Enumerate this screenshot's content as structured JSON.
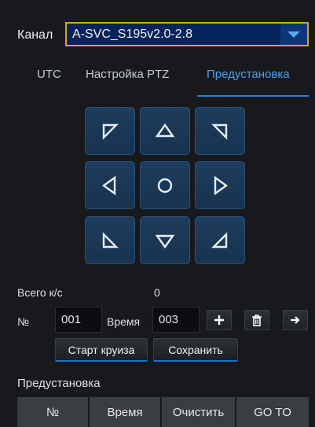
{
  "channel": {
    "label": "Канал",
    "value": "A-SVC_S195v2.0-2.8"
  },
  "tabs": [
    {
      "label": "UTC"
    },
    {
      "label": "Настройка PTZ"
    },
    {
      "label": "Предустановка"
    }
  ],
  "active_tab": "Предустановка",
  "ptz_pad": {
    "buttons": [
      "up-left",
      "up",
      "up-right",
      "left",
      "center",
      "right",
      "down-left",
      "down",
      "down-right"
    ]
  },
  "cruise": {
    "total_label": "Всего к/с",
    "total_value": "0",
    "number_label": "№",
    "number_value": "001",
    "time_label": "Время",
    "time_value": "003",
    "buttons": [
      "add-icon",
      "trash-icon",
      "arrow-right-icon"
    ],
    "start_label": "Старт круиза",
    "save_label": "Сохранить"
  },
  "preset_section": {
    "title": "Предустановка",
    "columns": [
      "№",
      "Время",
      "Очистить",
      "GO TO"
    ]
  },
  "colors": {
    "accent": "#2b7fd6",
    "select_border": "#d9a521",
    "pad_bg": "#1e3c5c"
  }
}
